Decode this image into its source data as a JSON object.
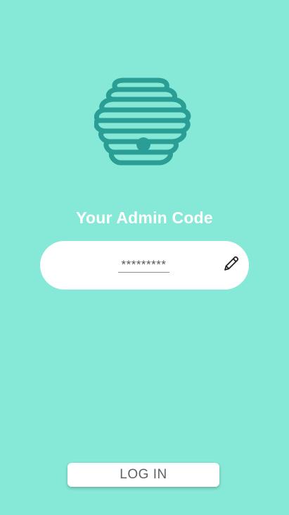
{
  "screen": {
    "title": "Your Admin Code",
    "code_value": "*********",
    "login_label": "LOG IN"
  },
  "icons": {
    "logo": "hive-logo-icon",
    "edit": "pencil-icon"
  },
  "colors": {
    "background": "#86e8d6",
    "accent": "#2a9d94",
    "text_light": "#ffffff",
    "text_dark": "#5f6368"
  }
}
